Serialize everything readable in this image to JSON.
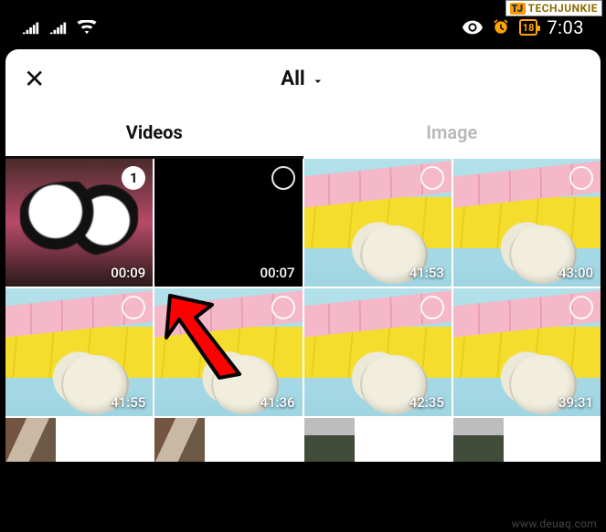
{
  "status": {
    "battery_text": "18",
    "clock": "7:03"
  },
  "watermarks": {
    "top": "TECHJUNKIE",
    "bottom": "www.deuaq.com"
  },
  "header": {
    "close_glyph": "✕",
    "title": "All"
  },
  "tabs": {
    "videos": "Videos",
    "image": "Image",
    "active": "videos"
  },
  "grid": [
    {
      "kind": "cat",
      "duration": "00:09",
      "selected": true,
      "badge": "1"
    },
    {
      "kind": "dark",
      "duration": "00:07",
      "selected": false
    },
    {
      "kind": "tape",
      "duration": "41:53",
      "selected": false
    },
    {
      "kind": "tape",
      "duration": "43:00",
      "selected": false
    },
    {
      "kind": "tape",
      "duration": "41:55",
      "selected": false
    },
    {
      "kind": "tape",
      "duration": "41:36",
      "selected": false
    },
    {
      "kind": "tape",
      "duration": "42:35",
      "selected": false
    },
    {
      "kind": "tape",
      "duration": "39:31",
      "selected": false
    },
    {
      "kind": "room",
      "duration": "",
      "selected": false,
      "partial": true
    },
    {
      "kind": "room",
      "duration": "",
      "selected": false,
      "partial": true
    },
    {
      "kind": "outdoor",
      "duration": "",
      "selected": false,
      "partial": true
    },
    {
      "kind": "outdoor",
      "duration": "",
      "selected": false,
      "partial": true
    }
  ]
}
